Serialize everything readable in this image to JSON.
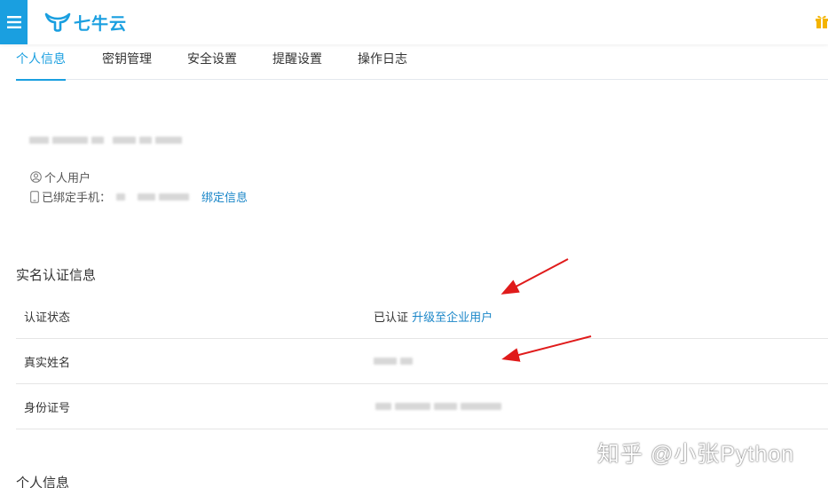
{
  "header": {
    "logo_text": "七牛云"
  },
  "tabs": [
    {
      "label": "个人信息",
      "active": true
    },
    {
      "label": "密钥管理",
      "active": false
    },
    {
      "label": "安全设置",
      "active": false
    },
    {
      "label": "提醒设置",
      "active": false
    },
    {
      "label": "操作日志",
      "active": false
    }
  ],
  "profile": {
    "user_type": "个人用户",
    "phone_label": "已绑定手机：",
    "bind_link": "绑定信息"
  },
  "realname": {
    "title": "实名认证信息",
    "rows": [
      {
        "label": "认证状态",
        "value": "已认证",
        "link": "升级至企业用户"
      },
      {
        "label": "真实姓名"
      },
      {
        "label": "身份证号"
      }
    ]
  },
  "next_section_title": "个人信息",
  "watermark": "知乎 @小张Python",
  "colors": {
    "accent": "#1a9fe0",
    "link": "#1a86c8",
    "arrow": "#e01b1b",
    "gift": "#f4b400"
  },
  "icons": [
    "menu-icon",
    "logo-ox-icon",
    "gift-icon",
    "user-icon",
    "phone-icon"
  ]
}
